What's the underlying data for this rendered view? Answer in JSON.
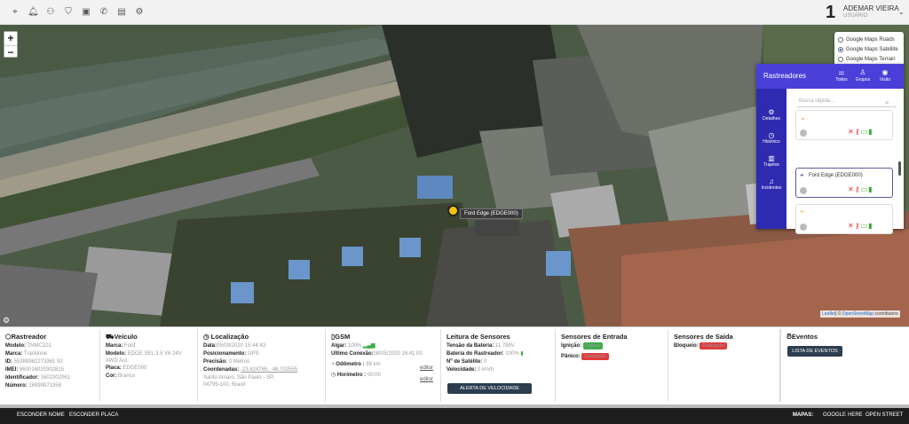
{
  "header": {
    "user_number": "1",
    "user_name": "ADEMAR VIEIRA",
    "user_role": "USUÁRIO"
  },
  "map": {
    "zoom_in": "+",
    "zoom_out": "−",
    "layers": [
      {
        "label": "Google Maps Roads",
        "selected": false
      },
      {
        "label": "Google Maps Satellite",
        "selected": true
      },
      {
        "label": "Google Maps Terrain",
        "selected": false
      }
    ],
    "marker_label": "Ford Edge (EDGE000)",
    "attribution_a": "Leaflet",
    "attribution_b": "| © ",
    "attribution_c": "OpenStreetMap",
    "attribution_d": " contributors"
  },
  "trackers_panel": {
    "title": "Rastreadores",
    "actions": [
      "Todos",
      "Grupos",
      "Visão"
    ],
    "side_menu": [
      "Detalhes",
      "Histórico",
      "Trajetos",
      "Incidentes"
    ],
    "search_placeholder": "Busca rápida...",
    "items": [
      {
        "name": ""
      },
      {
        "name": "Ford Edge (EDGE000)"
      },
      {
        "name": ""
      }
    ]
  },
  "info": {
    "rastreador": {
      "title": "Rastreador",
      "modelo_label": "Modelo:",
      "modelo": "TNMC101",
      "marca_label": "Marca:",
      "marca": "Trackinne",
      "id_label": "ID:",
      "id": "55388962273361 92",
      "imei_label": "IMEI:",
      "imei": "860016020302815",
      "ident_label": "Identificador:",
      "ident": "1602302061",
      "numero_label": "Número:",
      "numero": "16999971358"
    },
    "veiculo": {
      "title": "Veículo",
      "marca_label": "Marca:",
      "marca": "Ford",
      "modelo_label": "Modelo:",
      "modelo": "EDGE SEL 3.5 V6 24V AWD Aut.",
      "placa_label": "Placa:",
      "placa": "EDGE000",
      "cor_label": "Cor:",
      "cor": "Branco"
    },
    "localizacao": {
      "title": "Localização",
      "data_label": "Data:",
      "data": "05/03/2020 15:44:43",
      "pos_label": "Posicionamento:",
      "pos": "GPS",
      "prec_label": "Precisão:",
      "prec": "0 Metros",
      "coord_label": "Coordenadas:",
      "coord": "-23.624765, -46.702555",
      "endereco": "Santo Amaro, São Paulo - SP, 04795-100, Brasil"
    },
    "gsm": {
      "title": "GSM",
      "algar_label": "Algar:",
      "algar": "100%",
      "ultima_label": "Último Conexão:",
      "ultima": "08/05/2020 16:41:00",
      "odometro_label": "Odômetro :",
      "odometro": "89 km",
      "horimetro_label": "Horímetro :",
      "horimetro": "00:00",
      "editor": "editor"
    },
    "sensores": {
      "title": "Leitura de Sensores",
      "tensao_label": "Tensão da Bateria:",
      "tensao": "11.788V",
      "bateria_label": "Bateria do Rastreador:",
      "bateria": "100%",
      "satelite_label": "Nº de Satélite:",
      "satelite": "0",
      "velocidade_label": "Velocidade:",
      "velocidade": "0 km/h",
      "button": "ALERTA DE VELOCIDADE"
    },
    "entrada": {
      "title": "Sensores de Entrada",
      "ignicao_label": "Ignição:",
      "ignicao": "Ligado",
      "panico_label": "Pânico:",
      "panico": "Desligado"
    },
    "saida": {
      "title": "Sensores de Saída",
      "bloqueio_label": "Bloqueio:",
      "bloqueio": "Desligado"
    },
    "eventos": {
      "title": "Eventos",
      "button": "LISTA DE EVENTOS"
    }
  },
  "footer": {
    "esconder_nome": "ESCONDER NOME",
    "esconder_placa": "ESCONDER PLACA",
    "mapas_label": "MAPAS:",
    "map_google": "GOOGLE",
    "map_here": "HERE",
    "map_osm": "OPEN STREET"
  },
  "colors": {
    "panel_header": "#4a3fd8",
    "panel_side": "#2e2bb0",
    "badge_on": "#3cae4a",
    "badge_off": "#e13b3b",
    "footer_bg": "#1e1e1e"
  }
}
